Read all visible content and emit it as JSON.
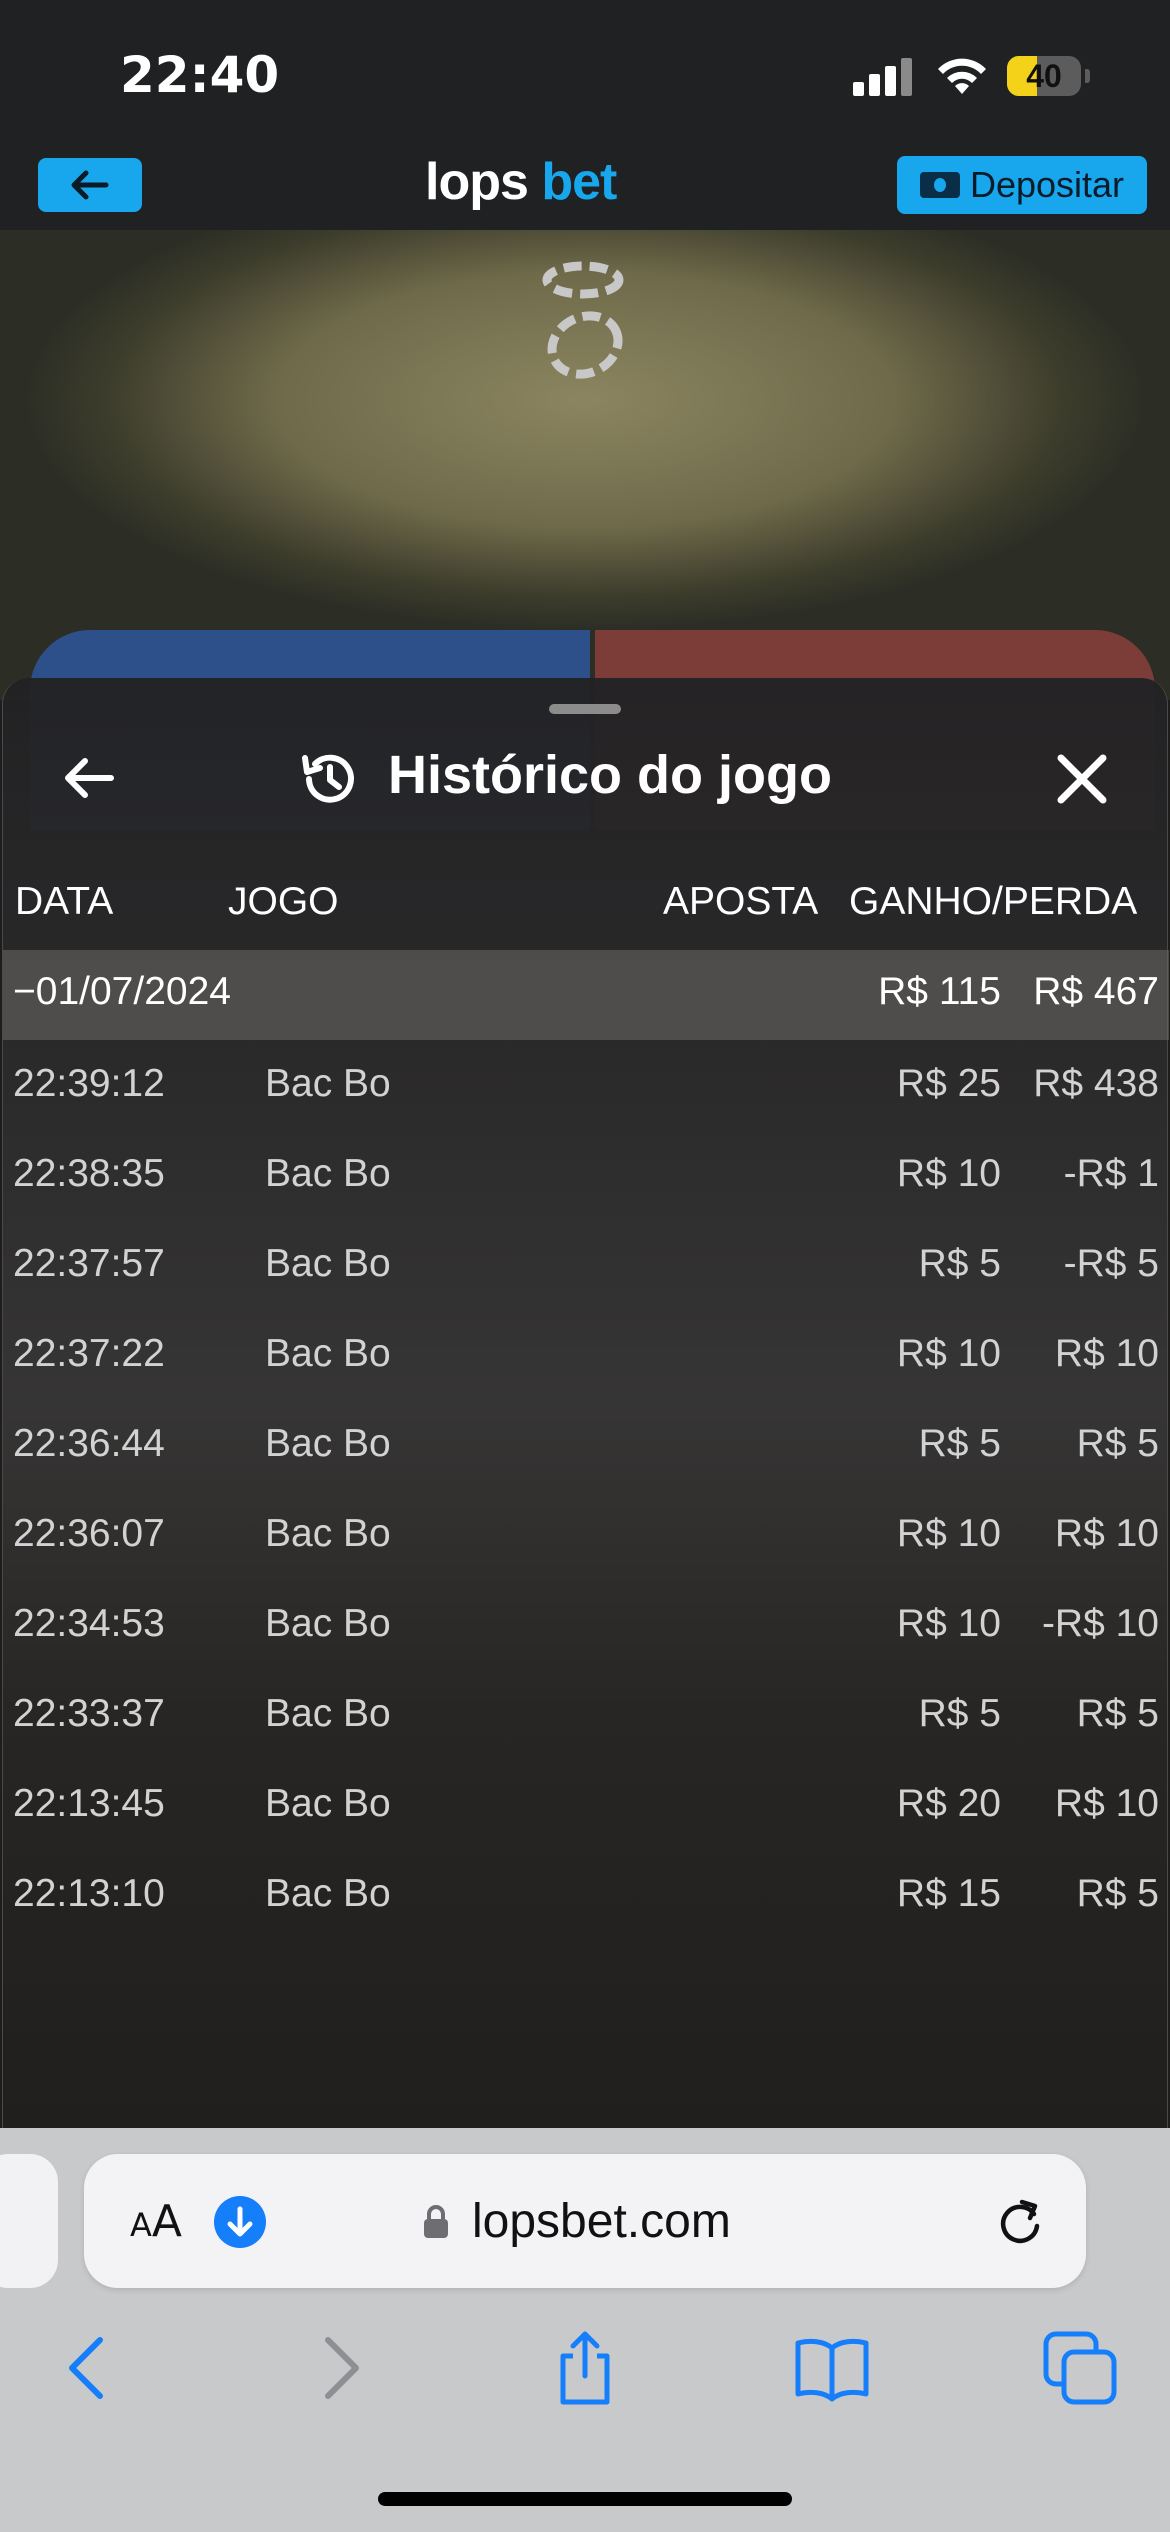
{
  "status_bar": {
    "time": "22:40",
    "battery": "40",
    "battery_level": 0.4
  },
  "header": {
    "logo_part1": "lops",
    "logo_part2": "bet",
    "deposit_label": "Depositar"
  },
  "history": {
    "title": "Histórico do jogo",
    "columns": {
      "date": "DATA",
      "game": "JOGO",
      "bet": "APOSTA",
      "win_loss": "GANHO/PERDA"
    },
    "group": {
      "date": "−01/07/2024",
      "bet_total": "R$ 115",
      "win_total": "R$ 467"
    },
    "rows": [
      {
        "time": "22:39:12",
        "game": "Bac Bo",
        "bet": "R$ 25",
        "result": "R$ 438"
      },
      {
        "time": "22:38:35",
        "game": "Bac Bo",
        "bet": "R$ 10",
        "result": "-R$ 1"
      },
      {
        "time": "22:37:57",
        "game": "Bac Bo",
        "bet": "R$ 5",
        "result": "-R$ 5"
      },
      {
        "time": "22:37:22",
        "game": "Bac Bo",
        "bet": "R$ 10",
        "result": "R$ 10"
      },
      {
        "time": "22:36:44",
        "game": "Bac Bo",
        "bet": "R$ 5",
        "result": "R$ 5"
      },
      {
        "time": "22:36:07",
        "game": "Bac Bo",
        "bet": "R$ 10",
        "result": "R$ 10"
      },
      {
        "time": "22:34:53",
        "game": "Bac Bo",
        "bet": "R$ 10",
        "result": "-R$ 10"
      },
      {
        "time": "22:33:37",
        "game": "Bac Bo",
        "bet": "R$ 5",
        "result": "R$ 5"
      },
      {
        "time": "22:13:45",
        "game": "Bac Bo",
        "bet": "R$ 20",
        "result": "R$ 10"
      },
      {
        "time": "22:13:10",
        "game": "Bac Bo",
        "bet": "R$ 15",
        "result": "R$ 5"
      }
    ]
  },
  "browser": {
    "aa_small": "A",
    "aa_big": "A",
    "url": "lopsbet.com",
    "icons": [
      "back-icon",
      "forward-icon",
      "share-icon",
      "bookmarks-icon",
      "tabs-icon"
    ]
  },
  "colors": {
    "accent": "#18a7ec",
    "battery": "#f4d21a",
    "safari_blue": "#147efb"
  }
}
